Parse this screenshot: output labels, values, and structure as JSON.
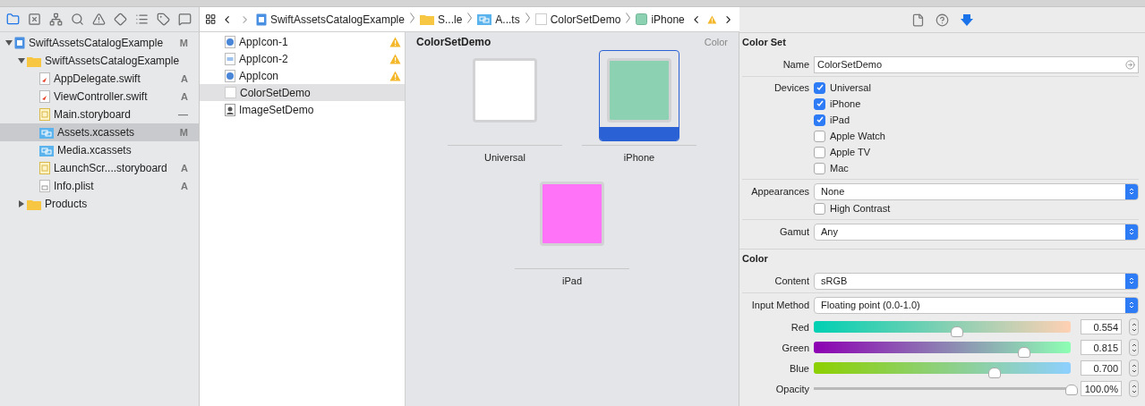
{
  "navigator_tabs": [
    {
      "kind": "folder",
      "selected": true
    },
    {
      "kind": "source",
      "selected": false
    },
    {
      "kind": "hierarchy",
      "selected": false
    },
    {
      "kind": "search",
      "selected": false
    },
    {
      "kind": "issue",
      "selected": false
    },
    {
      "kind": "test",
      "selected": false
    },
    {
      "kind": "debug",
      "selected": false
    },
    {
      "kind": "breakpoint",
      "selected": false
    },
    {
      "kind": "report",
      "selected": false
    }
  ],
  "navigator": [
    {
      "label": "SwiftAssetsCatalogExample",
      "kind": "project",
      "badge": "M",
      "expanded": true,
      "selected": false,
      "children": [
        {
          "label": "SwiftAssetsCatalogExample",
          "kind": "folder",
          "expanded": true,
          "selected": false,
          "children": [
            {
              "label": "AppDelegate.swift",
              "kind": "swift",
              "badge": "A",
              "selected": false
            },
            {
              "label": "ViewController.swift",
              "kind": "swift",
              "badge": "A",
              "selected": false
            },
            {
              "label": "Main.storyboard",
              "kind": "storyboard",
              "badge": "—",
              "selected": false
            },
            {
              "label": "Assets.xcassets",
              "kind": "xcassets",
              "badge": "M",
              "selected": true
            },
            {
              "label": "Media.xcassets",
              "kind": "xcassets",
              "selected": false
            },
            {
              "label": "LaunchScr....storyboard",
              "kind": "storyboard",
              "badge": "A",
              "selected": false
            },
            {
              "label": "Info.plist",
              "kind": "plist",
              "badge": "A",
              "selected": false
            }
          ]
        },
        {
          "label": "Products",
          "kind": "folder",
          "expanded": false,
          "selected": false
        }
      ]
    }
  ],
  "breadcrumb": [
    {
      "label": "SwiftAssetsCatalogExample",
      "kind": "project"
    },
    {
      "label": "S...le",
      "kind": "folder"
    },
    {
      "label": "A...ts",
      "kind": "xcassets"
    },
    {
      "label": "ColorSetDemo",
      "kind": "colorset"
    },
    {
      "label": "iPhone",
      "kind": "swatch"
    }
  ],
  "assets": [
    {
      "label": "AppIcon-1",
      "kind": "appicon",
      "warning": true,
      "selected": false
    },
    {
      "label": "AppIcon-2",
      "kind": "appicon-mac",
      "warning": true,
      "selected": false
    },
    {
      "label": "AppIcon",
      "kind": "appicon",
      "warning": true,
      "selected": false
    },
    {
      "label": "ColorSetDemo",
      "kind": "colorset",
      "warning": false,
      "selected": true
    },
    {
      "label": "ImageSetDemo",
      "kind": "imageset",
      "warning": false,
      "selected": false
    }
  ],
  "canvas": {
    "title": "ColorSetDemo",
    "type": "Color",
    "slots": [
      {
        "label": "Universal",
        "color": "#ffffff",
        "selected": false
      },
      {
        "label": "iPhone",
        "color": "#8dd1b3",
        "selected": true
      },
      {
        "label": "iPad",
        "color": "#ff73f8",
        "selected": false
      }
    ]
  },
  "inspector_tabs": [
    {
      "kind": "file",
      "selected": false
    },
    {
      "kind": "help",
      "selected": false
    },
    {
      "kind": "attributes",
      "selected": true
    }
  ],
  "color_set": {
    "title": "Color Set",
    "name_label": "Name",
    "name": "ColorSetDemo",
    "devices_label": "Devices",
    "devices": [
      {
        "label": "Universal",
        "checked": true
      },
      {
        "label": "iPhone",
        "checked": true
      },
      {
        "label": "iPad",
        "checked": true
      },
      {
        "label": "Apple Watch",
        "checked": false
      },
      {
        "label": "Apple TV",
        "checked": false
      },
      {
        "label": "Mac",
        "checked": false
      }
    ],
    "appearances_label": "Appearances",
    "appearances": "None",
    "high_contrast": {
      "label": "High Contrast",
      "checked": false
    },
    "gamut_label": "Gamut",
    "gamut": "Any"
  },
  "color": {
    "title": "Color",
    "content_label": "Content",
    "content": "sRGB",
    "input_method_label": "Input Method",
    "input_method": "Floating point (0.0-1.0)",
    "sliders": [
      {
        "label": "Red",
        "kind": "red",
        "level": 0.554,
        "reading": "0.554"
      },
      {
        "label": "Green",
        "kind": "green",
        "level": 0.815,
        "reading": "0.815"
      },
      {
        "label": "Blue",
        "kind": "blue",
        "level": 0.7,
        "reading": "0.700"
      },
      {
        "label": "Opacity",
        "kind": "opacity",
        "level": 1,
        "reading": "100.0%"
      }
    ]
  }
}
